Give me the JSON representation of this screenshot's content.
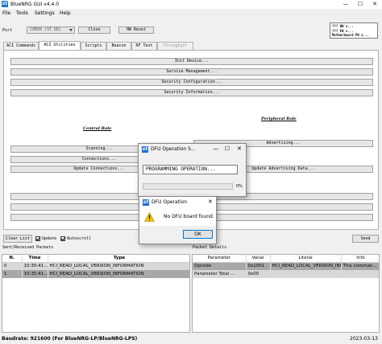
{
  "window": {
    "title": "BlueNRG GUI v4.4.0",
    "minimize": "—",
    "maximize": "☐",
    "close": "✕"
  },
  "menu": [
    "File",
    "Tools",
    "Settings",
    "Help"
  ],
  "port": {
    "label": "Port",
    "selected": "COM39 (ST DE)",
    "close_label": "Close",
    "reset_label": "HW Reset"
  },
  "fw_info": [
    "??? HW v... ",
    "??? FW v... ",
    "Motherboard FW v... "
  ],
  "tabs": [
    "ACI Commands",
    "ACI Utilities",
    "Scripts",
    "Beacon",
    "RF Test",
    "Throughput"
  ],
  "aci_utilities": {
    "top_buttons": [
      "Init Device...",
      "Service Management...",
      "Security Configuration...",
      "Security Information..."
    ],
    "central_heading": "Central Role",
    "peripheral_heading": "Peripheral Role",
    "central_buttons": [
      "Scanning...",
      "Connections...",
      "Update Connections..."
    ],
    "peripheral_buttons": [
      "Advertising...",
      "Update Advertising Data..."
    ]
  },
  "progress_dialog": {
    "title": "DFU Operation S...",
    "message": "PROGRAMMING OPERATION...",
    "percent_label": "0%",
    "progress": 0
  },
  "error_dialog": {
    "title": "DFU Operation",
    "message": "No DFU board found.",
    "ok_label": "OK"
  },
  "controls": {
    "clear_list": "Clear List",
    "update_label": "Update",
    "autoscroll_label": "Autoscroll",
    "send": "Send"
  },
  "sent_received": {
    "title": "Sent/Received Packets",
    "headers": [
      "N.",
      "Time",
      "Type"
    ],
    "rows": [
      [
        "0",
        "10:35:41...",
        "HCI_READ_LOCAL_VERSION_INFORMATION"
      ],
      [
        "1",
        "10:35:41...",
        "HCI_READ_LOCAL_VERSION_INFORMATION"
      ]
    ]
  },
  "packet_details": {
    "title": "Packet Details",
    "headers": [
      "Parameter",
      "Value",
      "Literal",
      "Info"
    ],
    "rows": [
      [
        "Opcode",
        "0x1001",
        "HCI_READ_LOCAL_VERSION_INFORMATION",
        "This comman..."
      ],
      [
        "Parameter Total ...",
        "0x00",
        "",
        ""
      ]
    ]
  },
  "status": {
    "left": "Baudrate: 921600 (For BlueNRG-LP/BlueNRG-LPS)",
    "right": "2023-03-13"
  }
}
